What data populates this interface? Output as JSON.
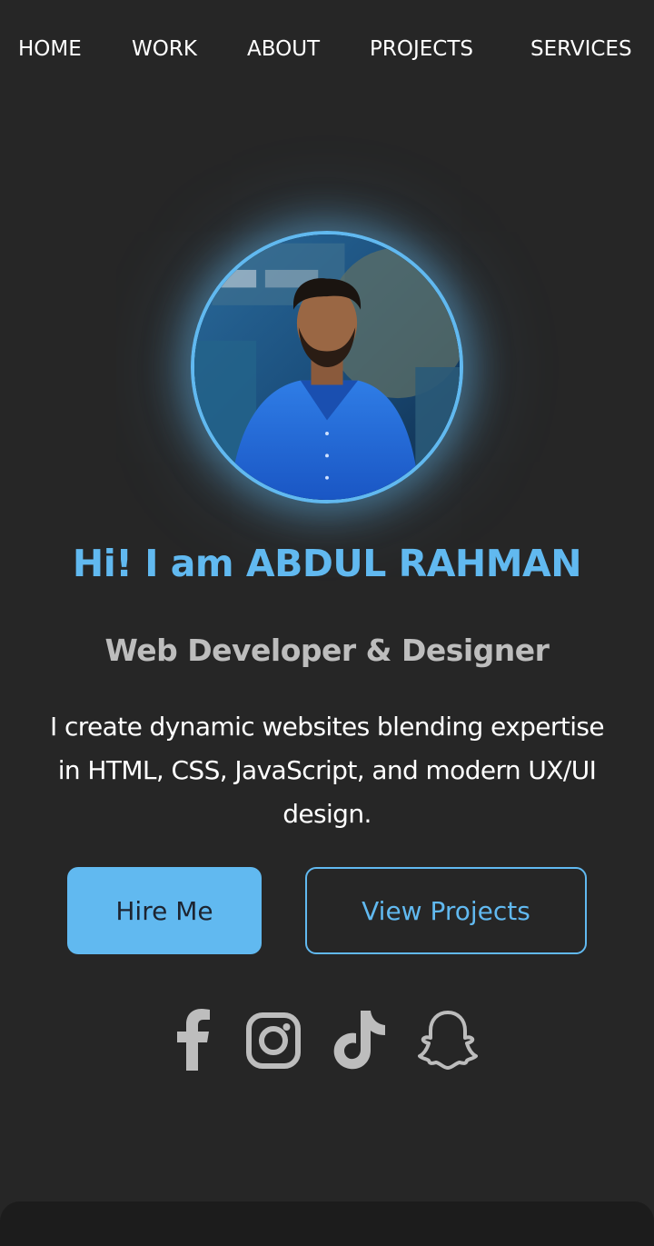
{
  "nav": {
    "items": [
      {
        "label": "HOME"
      },
      {
        "label": "WORK"
      },
      {
        "label": "ABOUT"
      },
      {
        "label": "PROJECTS"
      },
      {
        "label": "SERVICES"
      }
    ]
  },
  "hero": {
    "headline": "Hi! I am ABDUL RAHMAN",
    "role": "Web Developer & Designer",
    "description": "I create dynamic websites blending expertise in HTML, CSS, JavaScript, and modern UX/UI design."
  },
  "buttons": {
    "hire": "Hire Me",
    "projects": "View Projects"
  },
  "social": {
    "icons": [
      "facebook-icon",
      "instagram-icon",
      "tiktok-icon",
      "snapchat-icon"
    ]
  },
  "colors": {
    "background": "#262626",
    "accent": "#61b9f0",
    "role_text": "#bdbdbd",
    "icon": "#bdbdbd"
  }
}
